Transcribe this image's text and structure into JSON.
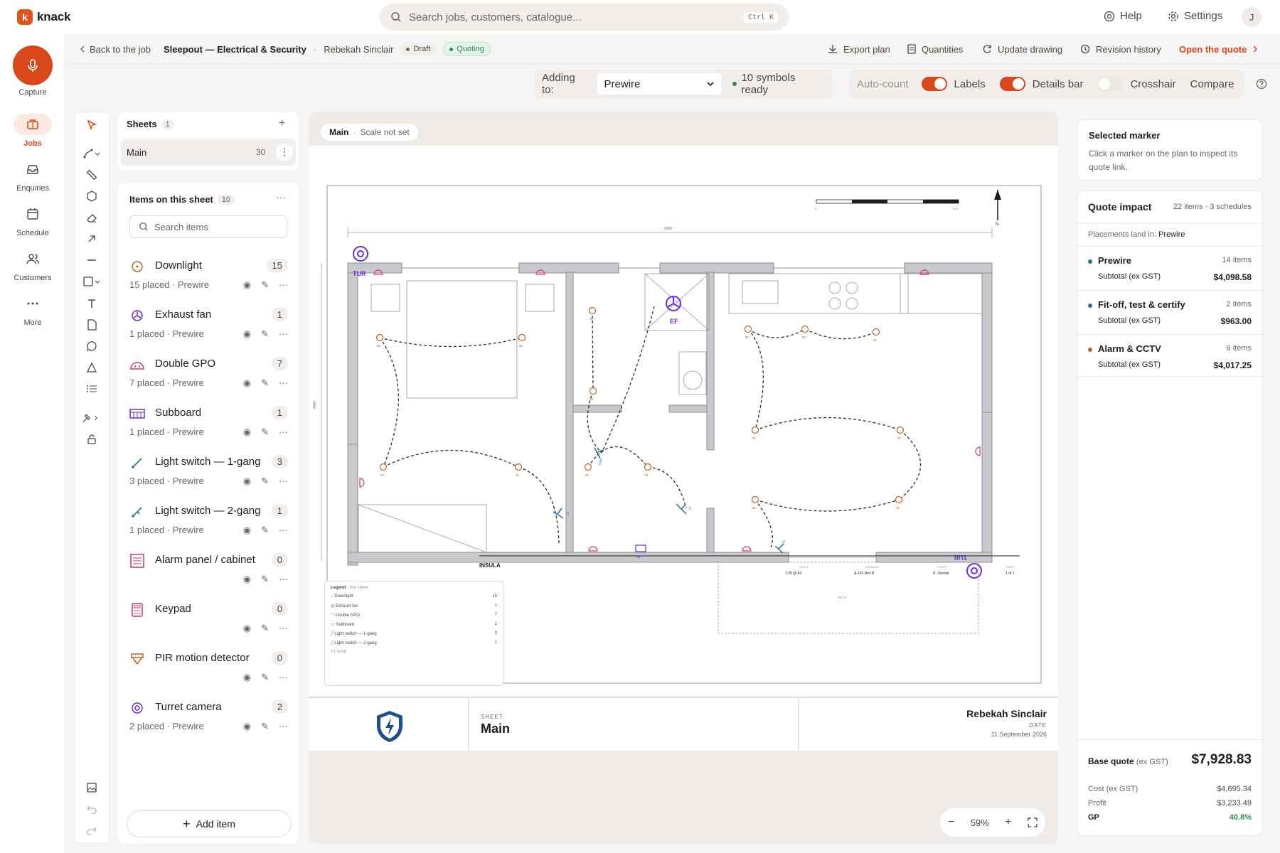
{
  "app": {
    "name": "knack",
    "logo_letter": "k"
  },
  "topbar": {
    "search_placeholder": "Search jobs, customers, catalogue...",
    "shortcut": "Ctrl K",
    "help": "Help",
    "settings": "Settings",
    "avatar": "J"
  },
  "nav": {
    "capture": "Capture",
    "items": [
      {
        "label": "Jobs",
        "icon": "briefcase-icon"
      },
      {
        "label": "Enquiries",
        "icon": "inbox-icon"
      },
      {
        "label": "Schedule",
        "icon": "calendar-icon"
      },
      {
        "label": "Customers",
        "icon": "users-icon"
      },
      {
        "label": "More",
        "icon": "more-icon"
      }
    ]
  },
  "breadcrumb": {
    "back": "Back to the job",
    "job": "Sleepout — Electrical & Security",
    "customer": "Rebekah Sinclair",
    "status1": "Draft",
    "status2": "Quoting"
  },
  "actions": {
    "export": "Export plan",
    "quantities": "Quantities",
    "update": "Update drawing",
    "revision": "Revision history",
    "open_quote": "Open the quote"
  },
  "controls": {
    "adding_to_label": "Adding to:",
    "adding_to_value": "Prewire",
    "symbols_ready": "10 symbols ready",
    "auto_count": "Auto-count",
    "labels": "Labels",
    "labels_on": true,
    "details_bar": "Details bar",
    "details_on": true,
    "crosshair": "Crosshair",
    "crosshair_on": false,
    "compare": "Compare"
  },
  "sheets": {
    "title": "Sheets",
    "count": "1",
    "items": [
      {
        "name": "Main",
        "count": "30"
      }
    ]
  },
  "items_panel": {
    "title": "Items on this sheet",
    "count": "10",
    "search_placeholder": "Search items",
    "add_label": "Add item",
    "items": [
      {
        "name": "Downlight",
        "count": "15",
        "meta": "15 placed · Prewire",
        "icon": "downlight-icon"
      },
      {
        "name": "Exhaust fan",
        "count": "1",
        "meta": "1 placed · Prewire",
        "icon": "exhaust-fan-icon"
      },
      {
        "name": "Double GPO",
        "count": "7",
        "meta": "7 placed · Prewire",
        "icon": "gpo-icon"
      },
      {
        "name": "Subboard",
        "count": "1",
        "meta": "1 placed · Prewire",
        "icon": "subboard-icon"
      },
      {
        "name": "Light switch — 1-gang",
        "count": "3",
        "meta": "3 placed · Prewire",
        "icon": "switch-icon"
      },
      {
        "name": "Light switch — 2-gang",
        "count": "1",
        "meta": "1 placed · Prewire",
        "icon": "switch-icon"
      },
      {
        "name": "Alarm panel / cabinet",
        "count": "0",
        "meta": "",
        "icon": "alarm-panel-icon"
      },
      {
        "name": "Keypad",
        "count": "0",
        "meta": "",
        "icon": "keypad-icon"
      },
      {
        "name": "PIR motion detector",
        "count": "0",
        "meta": "",
        "icon": "pir-icon"
      },
      {
        "name": "Turret camera",
        "count": "2",
        "meta": "2 placed · Prewire",
        "icon": "camera-icon"
      }
    ]
  },
  "canvas": {
    "sheet_chip": "Main",
    "scale_chip": "Scale not set",
    "dimension_top": "9000",
    "dimension_side": "4000",
    "ef_label": "EF",
    "tur_label": "TUR",
    "sw2_label": "SW2",
    "dl_label": "DL",
    "s1_label": "S1",
    "gpo_label": "GPO",
    "sb_label": "SB",
    "deck_label": "DECK",
    "north": "N",
    "scale_zero": "0",
    "scale_end": "5 m",
    "insula": "INSULA",
    "legend": {
      "title": "Legend",
      "subtitle": "this sheet",
      "items": [
        {
          "name": "Downlight",
          "count": "15"
        },
        {
          "name": "Exhaust fan",
          "count": "1"
        },
        {
          "name": "Double GPO",
          "count": "7"
        },
        {
          "name": "Subboard",
          "count": "1"
        },
        {
          "name": "Light switch — 1-gang",
          "count": "3"
        },
        {
          "name": "Light switch — 2-gang",
          "count": "1"
        }
      ],
      "more": "+1 more"
    },
    "titleblock": {
      "scale_h": "SCALE",
      "scale_v": "1:25 @ A3",
      "drawing_h": "DRAWING",
      "drawing_v": "A-101 Rev B",
      "client_h": "CLIENT",
      "client_v": "R. Sinclair",
      "sheet_h": "SHEET",
      "sheet_v": "1 of 1"
    },
    "footer": {
      "sheet_label": "SHEET",
      "sheet_name": "Main",
      "client_name": "Rebekah Sinclair",
      "date_label": "DATE",
      "date_value": "11 September 2026"
    },
    "zoom": "59%"
  },
  "selected_marker": {
    "title": "Selected marker",
    "body": "Click a marker on the plan to inspect its quote link."
  },
  "quote_impact": {
    "title": "Quote impact",
    "summary": "22 items · 3 schedules",
    "placement_prefix": "Placements land in:",
    "placement_target": "Prewire",
    "schedules": [
      {
        "name": "Prewire",
        "items": "14 items",
        "subtotal_label": "Subtotal (ex GST)",
        "subtotal": "$4,098.58",
        "color": "#2c6f91"
      },
      {
        "name": "Fit-off, test & certify",
        "items": "2 items",
        "subtotal_label": "Subtotal (ex GST)",
        "subtotal": "$963.00",
        "color": "#2c6f91"
      },
      {
        "name": "Alarm & CCTV",
        "items": "6 items",
        "subtotal_label": "Subtotal (ex GST)",
        "subtotal": "$4,017.25",
        "color": "#c2621c"
      }
    ],
    "base_label": "Base quote",
    "base_suffix": "(ex GST)",
    "base_value": "$7,928.83",
    "cost_label": "Cost (ex GST)",
    "cost_value": "$4,695.34",
    "profit_label": "Profit",
    "profit_value": "$3,233.49",
    "gp_label": "GP",
    "gp_value": "40.8%"
  },
  "colors": {
    "accent": "#d9481b",
    "green": "#2f8a4e",
    "violet": "#6a2fd6",
    "blue": "#2c6f91"
  }
}
